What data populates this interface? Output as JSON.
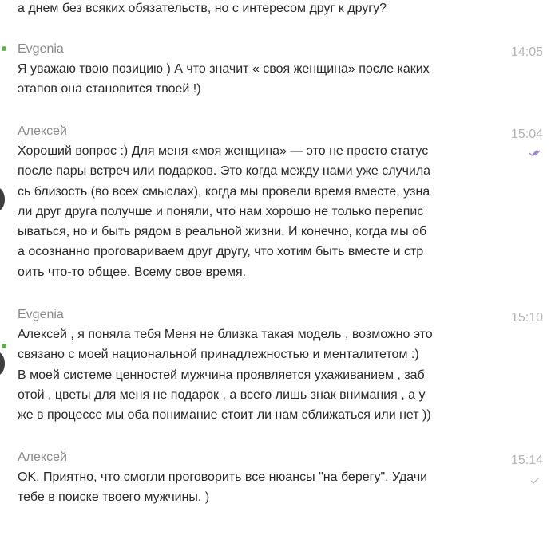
{
  "prev_tail": "а днем без всяких обязательств, но с интересом друг к другу?",
  "messages": [
    {
      "author": "Evgenia",
      "time": "14:05",
      "lines": [
        "Я уважаю твою позицию ) А что значит « своя женщина» после каких",
        "этапов она становится твоей !)"
      ]
    },
    {
      "author": "Алексей",
      "time": "15:04",
      "status": "read",
      "status_color": "#9b7fc7",
      "lines": [
        "Хороший вопрос :) Для меня «моя женщина» — это не просто статус",
        "после пары встреч или подарков. Это когда между нами уже случила",
        "сь близость (во всех смыслах), когда мы провели время вместе, узна",
        "ли друг друга получше и поняли, что нам хорошо не только перепис",
        "ываться, но и быть рядом в реальной жизни. И конечно, когда мы об",
        "а осознанно проговариваем друг другу, что хотим быть вместе и стр",
        "оить что-то общее. Всему свое время."
      ]
    },
    {
      "author": "Evgenia",
      "time": "15:10",
      "lines": [
        "Алексей , я поняла тебя Меня не близка такая модель , возможно это",
        "связано с моей национальной принадлежностью и менталитетом :)",
        "В моей системе ценностей мужчина проявляется ухаживанием , заб",
        "отой , цветы для меня не подарок , а всего лишь знак внимания , а у",
        "же в процессе мы оба понимание стоит ли нам сближаться или нет ))"
      ]
    },
    {
      "author": "Алексей",
      "time": "15:14",
      "status": "sent",
      "status_color": "#b8b8b8",
      "lines": [
        "OK. Приятно, что смогли проговорить все нюансы \"на берегу\". Удачи",
        "тебе в поиске твоего мужчины. )"
      ]
    }
  ]
}
